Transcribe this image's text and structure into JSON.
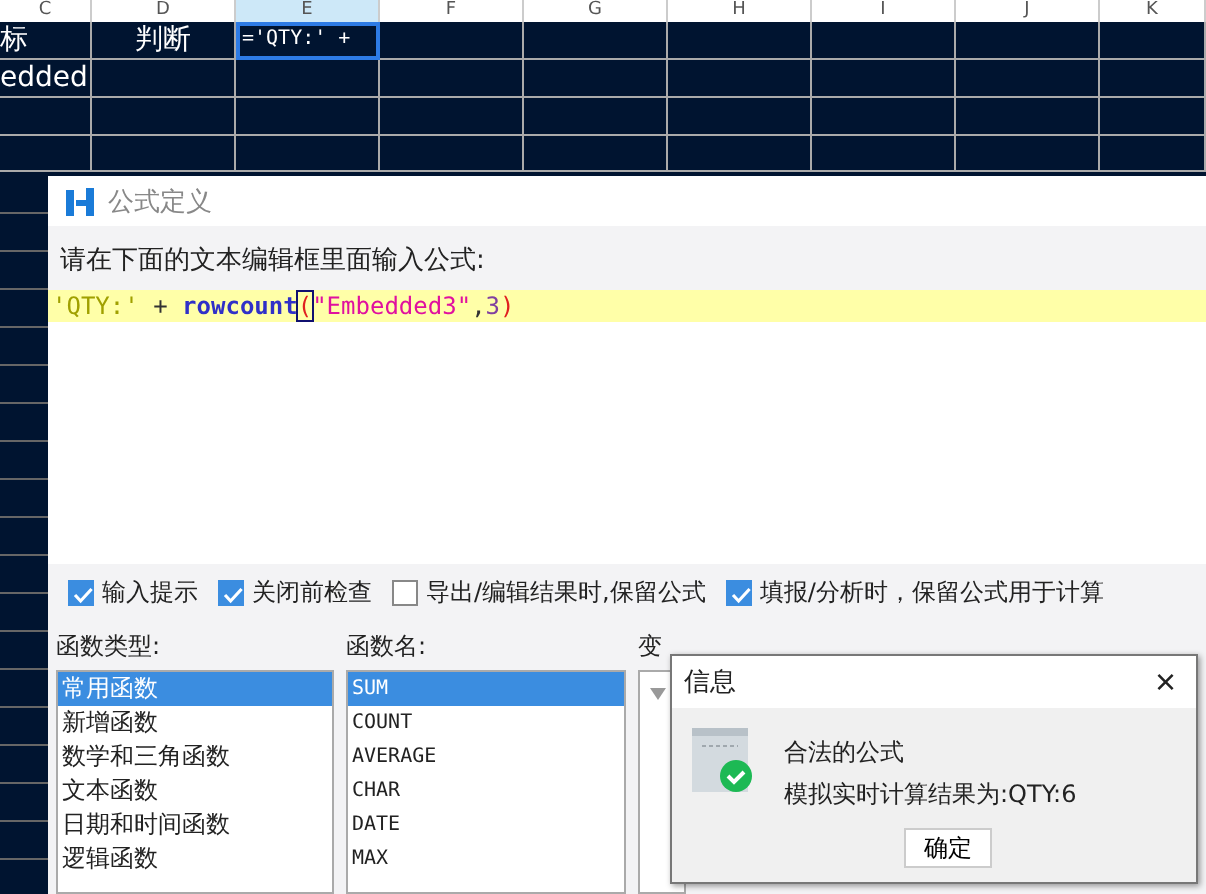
{
  "sheet": {
    "columns": [
      {
        "label": "C",
        "selected": false
      },
      {
        "label": "D",
        "selected": false
      },
      {
        "label": "E",
        "selected": true
      },
      {
        "label": "F",
        "selected": false
      },
      {
        "label": "G",
        "selected": false
      },
      {
        "label": "H",
        "selected": false
      },
      {
        "label": "I",
        "selected": false
      },
      {
        "label": "J",
        "selected": false
      },
      {
        "label": "K",
        "selected": false
      }
    ],
    "rows": [
      {
        "cells": [
          {
            "text": "标",
            "selected": false
          },
          {
            "text": "判断",
            "selected": false
          },
          {
            "text": "='QTY:' +",
            "selected": true
          }
        ]
      },
      {
        "cells": [
          {
            "text": "edded",
            "selected": false
          }
        ]
      }
    ]
  },
  "formula_dialog": {
    "title": "公式定义",
    "prompt": "请在下面的文本编辑框里面输入公式:",
    "formula": [
      {
        "kind": "string",
        "text": "'QTY:'"
      },
      {
        "kind": "operator",
        "text": " + "
      },
      {
        "kind": "function",
        "text": "rowcount"
      },
      {
        "kind": "paren",
        "text": "("
      },
      {
        "kind": "string2",
        "text": "\"Embedded3\""
      },
      {
        "kind": "punct",
        "text": ","
      },
      {
        "kind": "number",
        "text": "3"
      },
      {
        "kind": "paren",
        "text": ")"
      }
    ],
    "options": [
      {
        "label": "输入提示",
        "checked": true
      },
      {
        "label": "关闭前检查",
        "checked": true
      },
      {
        "label": "导出/编辑结果时,保留公式",
        "checked": false
      },
      {
        "label": "填报/分析时，保留公式用于计算",
        "checked": true
      }
    ],
    "function_types": {
      "label": "函数类型:",
      "items": [
        {
          "label": "常用函数",
          "selected": true
        },
        {
          "label": "新增函数",
          "selected": false
        },
        {
          "label": "数学和三角函数",
          "selected": false
        },
        {
          "label": "文本函数",
          "selected": false
        },
        {
          "label": "日期和时间函数",
          "selected": false
        },
        {
          "label": "逻辑函数",
          "selected": false
        }
      ]
    },
    "function_names": {
      "label": "函数名:",
      "items": [
        {
          "label": "SUM",
          "selected": true
        },
        {
          "label": "COUNT",
          "selected": false
        },
        {
          "label": "AVERAGE",
          "selected": false
        },
        {
          "label": "CHAR",
          "selected": false
        },
        {
          "label": "DATE",
          "selected": false
        },
        {
          "label": "MAX",
          "selected": false
        }
      ]
    },
    "variables": {
      "label": "变"
    }
  },
  "message_dialog": {
    "title": "信息",
    "close": "×",
    "lines": [
      "合法的公式",
      "模拟实时计算结果为:QTY:6"
    ],
    "button": "确定"
  }
}
